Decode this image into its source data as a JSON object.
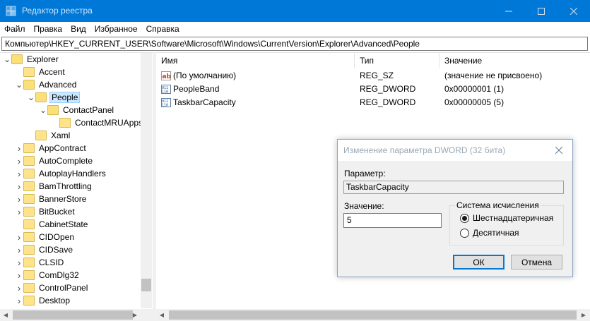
{
  "window": {
    "title": "Редактор реестра",
    "icon": "registry-editor-icon",
    "controls": [
      "minimize-icon",
      "maximize-icon",
      "close-icon"
    ]
  },
  "menu": [
    "Файл",
    "Правка",
    "Вид",
    "Избранное",
    "Справка"
  ],
  "address": "Компьютер\\HKEY_CURRENT_USER\\Software\\Microsoft\\Windows\\CurrentVersion\\Explorer\\Advanced\\People",
  "tree": {
    "items": [
      {
        "label": "Explorer",
        "level": 0,
        "expander": "expanded",
        "selected": false
      },
      {
        "label": "Accent",
        "level": 1,
        "expander": "none",
        "selected": false
      },
      {
        "label": "Advanced",
        "level": 1,
        "expander": "expanded",
        "selected": false
      },
      {
        "label": "People",
        "level": 2,
        "expander": "expanded",
        "selected": true
      },
      {
        "label": "ContactPanel",
        "level": 3,
        "expander": "expanded",
        "selected": false
      },
      {
        "label": "ContactMRUApps",
        "level": 4,
        "expander": "none",
        "selected": false
      },
      {
        "label": "Xaml",
        "level": 2,
        "expander": "none",
        "selected": false
      },
      {
        "label": "AppContract",
        "level": 1,
        "expander": "collapsed",
        "selected": false
      },
      {
        "label": "AutoComplete",
        "level": 1,
        "expander": "collapsed",
        "selected": false
      },
      {
        "label": "AutoplayHandlers",
        "level": 1,
        "expander": "collapsed",
        "selected": false
      },
      {
        "label": "BamThrottling",
        "level": 1,
        "expander": "collapsed",
        "selected": false
      },
      {
        "label": "BannerStore",
        "level": 1,
        "expander": "collapsed",
        "selected": false
      },
      {
        "label": "BitBucket",
        "level": 1,
        "expander": "collapsed",
        "selected": false
      },
      {
        "label": "CabinetState",
        "level": 1,
        "expander": "none",
        "selected": false
      },
      {
        "label": "CIDOpen",
        "level": 1,
        "expander": "collapsed",
        "selected": false
      },
      {
        "label": "CIDSave",
        "level": 1,
        "expander": "collapsed",
        "selected": false
      },
      {
        "label": "CLSID",
        "level": 1,
        "expander": "collapsed",
        "selected": false
      },
      {
        "label": "ComDlg32",
        "level": 1,
        "expander": "collapsed",
        "selected": false
      },
      {
        "label": "ControlPanel",
        "level": 1,
        "expander": "collapsed",
        "selected": false
      },
      {
        "label": "Desktop",
        "level": 1,
        "expander": "collapsed",
        "selected": false
      }
    ]
  },
  "list": {
    "columns": [
      "Имя",
      "Тип",
      "Значение"
    ],
    "rows": [
      {
        "icon": "string-value-icon",
        "name": "(По умолчанию)",
        "type": "REG_SZ",
        "value": "(значение не присвоено)"
      },
      {
        "icon": "binary-value-icon",
        "name": "PeopleBand",
        "type": "REG_DWORD",
        "value": "0x00000001 (1)"
      },
      {
        "icon": "binary-value-icon",
        "name": "TaskbarCapacity",
        "type": "REG_DWORD",
        "value": "0x00000005 (5)"
      }
    ]
  },
  "dialog": {
    "title": "Изменение параметра DWORD (32 бита)",
    "name_label": "Параметр:",
    "name_value": "TaskbarCapacity",
    "value_label": "Значение:",
    "value_value": "5",
    "base_group": "Система исчисления",
    "hex_label": "Шестнадцатеричная",
    "dec_label": "Десятичная",
    "selected_base": "hex",
    "ok_label": "ОК",
    "cancel_label": "Отмена"
  },
  "colors": {
    "titlebar": "#0078d7",
    "selection": "#cce8ff",
    "folder": "#ffe38a"
  }
}
